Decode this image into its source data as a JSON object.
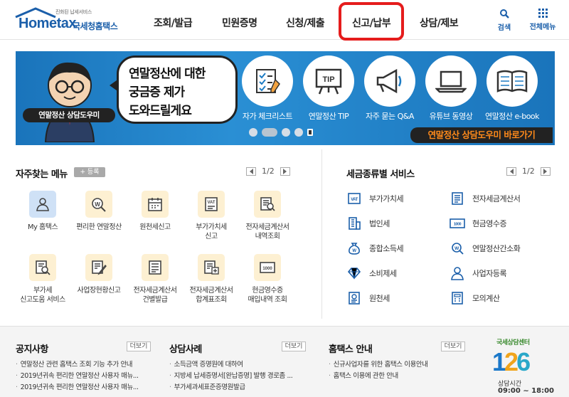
{
  "header": {
    "logo_small": "진화된 납세서비스",
    "logo_home": "Hometax",
    "logo_kr": "국세청홈택스",
    "nav": [
      "조회/발급",
      "민원증명",
      "신청/제출",
      "신고/납부",
      "상담/제보"
    ],
    "search_label": "검색",
    "menu_label": "전체메뉴"
  },
  "banner": {
    "bubble_lines": [
      "연말정산에 대한",
      "궁금증 제가",
      "도와드릴게요"
    ],
    "char_label": "연말정산 상담도우미",
    "services": [
      "자가 체크리스트",
      "연말정산 TIP",
      "자주 묻는 Q&A",
      "유튜브 동영상",
      "연말정산 e-book"
    ],
    "tip_text": "TIP",
    "cta": "연말정산 상담도우미 바로가기"
  },
  "favorites": {
    "title": "자주찾는 메뉴",
    "register": "+ 등록",
    "page": "1/2",
    "items": [
      "My 홈택스",
      "편리한 연말정산",
      "원천세신고",
      "부가가치세|신고",
      "전자세금계산서|내역조회",
      "부가세|신고도움 서비스",
      "사업장현황신고",
      "전자세금계산서|건별발급",
      "전자세금계산서|합계표조회",
      "현금영수증|매입내역 조회"
    ]
  },
  "tax_services": {
    "title": "세금종류별 서비스",
    "page": "1/2",
    "left": [
      "부가가치세",
      "법인세",
      "종합소득세",
      "소비제세",
      "원천세"
    ],
    "right": [
      "전자세금계산서",
      "현금영수증",
      "연말정산간소화",
      "사업자등록",
      "모의계산"
    ]
  },
  "footer": {
    "notice": {
      "title": "공지사항",
      "more": "더보기",
      "items": [
        "연말정산 관련 홈택스 조회 기능 추가 안내",
        "2019년귀속 편리한 연말정산 사용자 매뉴...",
        "2019년귀속 편리한 연말정산 사용자 매뉴..."
      ]
    },
    "cases": {
      "title": "상담사례",
      "more": "더보기",
      "items": [
        "소득금액 증명원에 대하여",
        "지방세 납세증명서[완납증명] 발행 경로좀 ...",
        "부가세과세표준증명원발급"
      ]
    },
    "guide": {
      "title": "홈택스 안내",
      "more": "더보기",
      "items": [
        "신규사업자를 위한 홈택스 이용안내",
        "홈택스 이용에 관한 안내"
      ]
    },
    "center": {
      "label": "국세상담센터",
      "number": "126",
      "hours_label": "상담시간",
      "hours": "09:00 ~ 18:00"
    }
  },
  "colors": {
    "brand_blue": "#1b5faa",
    "banner_blue": "#1d7cc4",
    "highlight_red": "#e51c1c",
    "cta_orange": "#ff8a1a"
  }
}
